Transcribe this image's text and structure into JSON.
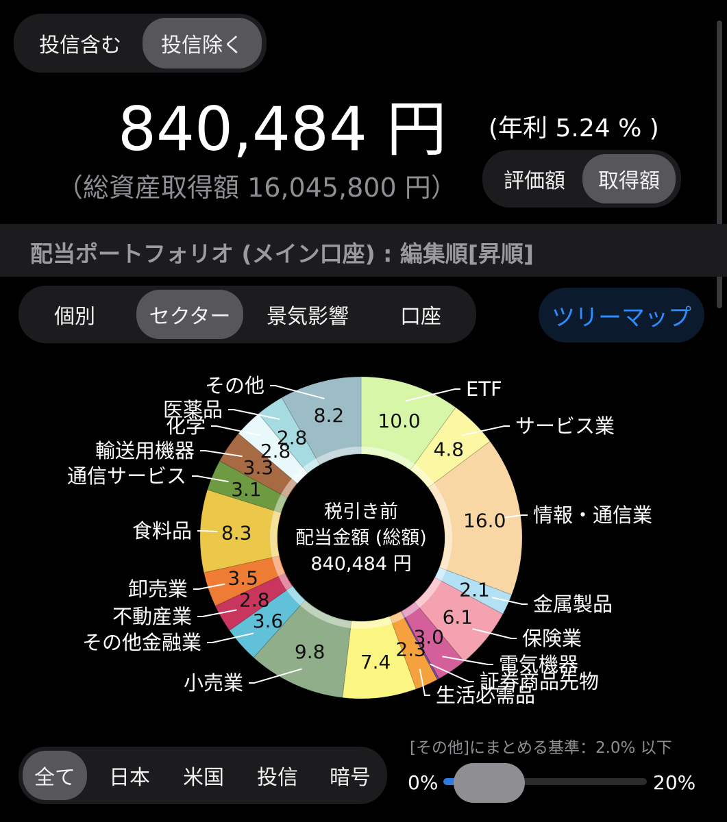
{
  "top_toggle": {
    "include": "投信含む",
    "exclude": "投信除く"
  },
  "summary": {
    "amount": "840,484 円",
    "annual_rate": "(年利 5.24 % )",
    "acquisition": "（総資産取得額 16,045,800 円）"
  },
  "value_toggle": {
    "valuation": "評価額",
    "acquisition": "取得額"
  },
  "portfolio_title": "配当ポートフォリオ (メイン口座) : 編集順[昇順]",
  "category_tabs": {
    "individual": "個別",
    "sector": "セクター",
    "economy": "景気影響",
    "account": "口座"
  },
  "treemap_button": "ツリーマップ",
  "chart_data": {
    "type": "pie",
    "center": {
      "line1": "税引き前",
      "line2": "配当金額 (総額)",
      "line3": "840,484 円"
    },
    "slices": [
      {
        "name": "ETF",
        "value": 10.0,
        "label": "10.0",
        "color": "#d7f6a8"
      },
      {
        "name": "サービス業",
        "value": 4.8,
        "label": "4.8",
        "color": "#fbf7a2"
      },
      {
        "name": "情報・通信業",
        "value": 16.0,
        "label": "16.0",
        "color": "#f9d7a5"
      },
      {
        "name": "金属製品",
        "value": 2.1,
        "label": "2.1",
        "color": "#b2e0f5"
      },
      {
        "name": "保険業",
        "value": 6.1,
        "label": "6.1",
        "color": "#f4a2b0"
      },
      {
        "name": "電気機器",
        "value": 3.0,
        "label": "3.0",
        "color": "#d35f9b"
      },
      {
        "name": "証券商品先物",
        "value": 0.2,
        "label": "",
        "color": "#7a4a9e"
      },
      {
        "name": "生活必需品",
        "value": 2.3,
        "label": "2.3",
        "color": "#f5a13d"
      },
      {
        "name": "",
        "value": 7.4,
        "label": "7.4",
        "color": "#fbf582"
      },
      {
        "name": "小売業",
        "value": 9.8,
        "label": "9.8",
        "color": "#8fae89"
      },
      {
        "name": "その他金融業",
        "value": 3.6,
        "label": "3.6",
        "color": "#61c1d9"
      },
      {
        "name": "不動産業",
        "value": 2.8,
        "label": "2.8",
        "color": "#c8365e"
      },
      {
        "name": "卸売業",
        "value": 3.5,
        "label": "3.5",
        "color": "#ef7c35"
      },
      {
        "name": "食料品",
        "value": 8.3,
        "label": "8.3",
        "color": "#ebc74a"
      },
      {
        "name": "通信サービス",
        "value": 3.1,
        "label": "3.1",
        "color": "#6e9a42"
      },
      {
        "name": "輸送用機器",
        "value": 3.3,
        "label": "3.3",
        "color": "#a86a43"
      },
      {
        "name": "化学",
        "value": 2.8,
        "label": "2.8",
        "color": "#e9f8fb"
      },
      {
        "name": "医薬品",
        "value": 2.8,
        "label": "2.8",
        "color": "#a6dbe2"
      },
      {
        "name": "その他",
        "value": 8.2,
        "label": "8.2",
        "color": "#9cbcc6"
      }
    ]
  },
  "region_tabs": {
    "all": "全て",
    "japan": "日本",
    "us": "米国",
    "fund": "投信",
    "crypto": "暗号"
  },
  "merge_threshold": {
    "label": "[その他]にまとめる基準：2.0% 以下",
    "min": "0%",
    "max": "20%",
    "value": 2.0
  }
}
